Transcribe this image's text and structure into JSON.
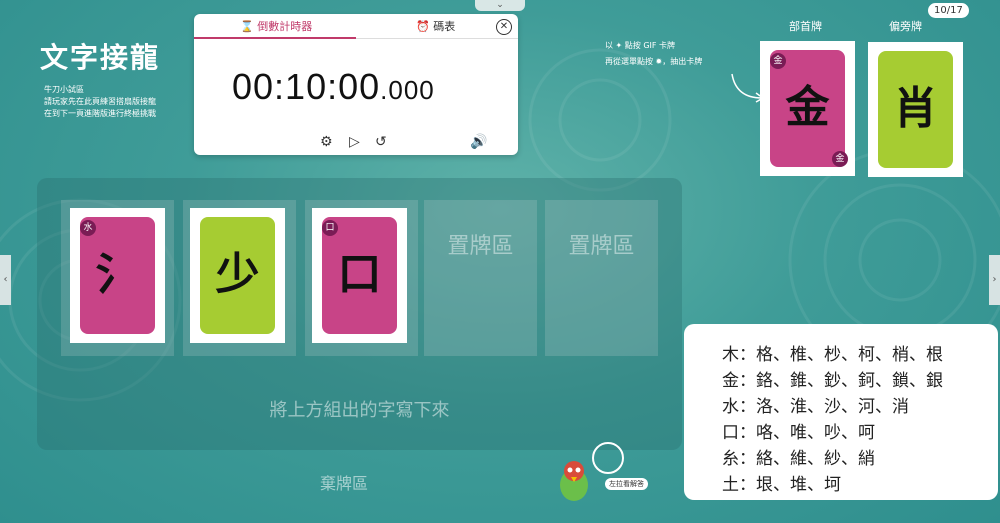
{
  "title": "文字接龍",
  "desc_lines": [
    "牛刀小試區",
    "請玩家先在此頁練習搭扇版接龍",
    "在到下一頁進階版進行終極挑戰"
  ],
  "top_chevron": "⌄",
  "timer": {
    "tab_countdown": "⌛ 倒數計時器",
    "tab_stopwatch": "⏰ 碼表",
    "close": "✕",
    "display_main": "00:10:00",
    "display_ms": ".000",
    "settings_icon": "⚙",
    "play_icon": "▷",
    "reset_icon": "↺",
    "sound_icon": "🔊"
  },
  "hint_lines": [
    "以 ✦ 點按 GIF 卡牌",
    "再從選單點按 ✹，抽出卡牌"
  ],
  "counter": "10/17",
  "radical_label": "部首牌",
  "side_label": "偏旁牌",
  "radical_card": {
    "char": "金",
    "badge": "金",
    "badge2": "金"
  },
  "side_card": {
    "char": "肖"
  },
  "board_cards": [
    {
      "char": "氵",
      "badge": "水",
      "color": "#c84487"
    },
    {
      "char": "少",
      "badge": "",
      "color": "#a6cc32"
    },
    {
      "char": "口",
      "badge": "口",
      "color": "#c84487"
    }
  ],
  "placeholder": "置牌區",
  "write_hint": "將上方組出的字寫下來",
  "discard": "棄牌區",
  "mascot_label": "左拉看解答",
  "answers": [
    "木：格、椎、杪、柯、梢、根",
    "金：鉻、錐、鈔、鈳、鎖、銀",
    "水：洛、淮、沙、河、消",
    "口：咯、唯、吵、呵",
    "糸：絡、維、紗、綃",
    "土：垠、堆、坷"
  ],
  "colors": {
    "pink": "#c84487",
    "green": "#a6cc32",
    "teal": "#3f9c98"
  }
}
